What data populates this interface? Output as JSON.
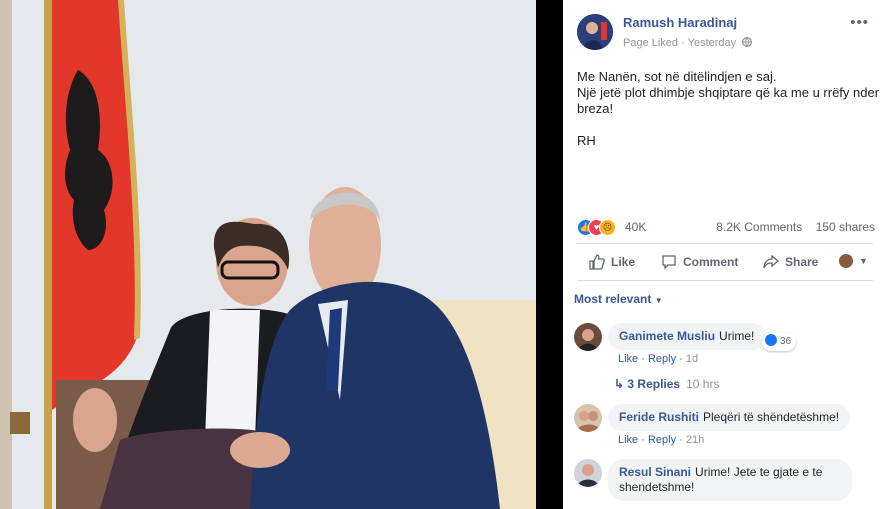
{
  "post": {
    "author": "Ramush Haradinaj",
    "liked_label": "Page Liked",
    "time": "Yesterday",
    "more_label": "•••",
    "text_lines": [
      "Me Nanën, sot në ditëlindjen e saj.",
      "Një jetë plot dhimbje shqiptare që ka me u rrëfy nder",
      "breza!",
      "",
      "RH"
    ],
    "reactions_count": "40K",
    "comments_count": "8.2K Comments",
    "shares_count": "150 shares"
  },
  "actions": {
    "like": "Like",
    "comment": "Comment",
    "share": "Share"
  },
  "sort_label": "Most relevant",
  "comments": [
    {
      "author": "Ganimete Musliu",
      "text": "Urime!",
      "like": "Like",
      "reply": "Reply",
      "time": "1d",
      "reaction_count": "36",
      "replies": "3 Replies",
      "replies_time": "10 hrs"
    },
    {
      "author": "Feride Rushiti",
      "text": "Pleqëri të shëndetëshme!",
      "like": "Like",
      "reply": "Reply",
      "time": "21h"
    },
    {
      "author": "Resul Sinani",
      "text_line1": "Urime! Jete te gjate e te",
      "text_line2": "shendetshme!"
    }
  ],
  "colors": {
    "link": "#385898",
    "flag_red": "#e2372a",
    "suit": "#1f3566"
  }
}
